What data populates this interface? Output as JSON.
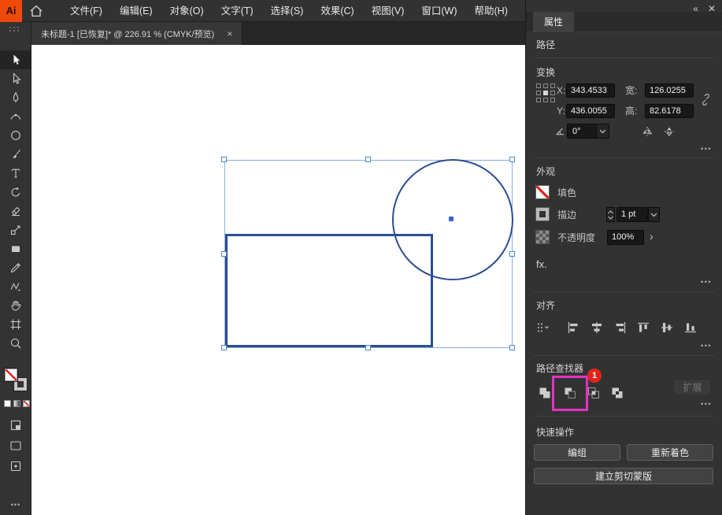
{
  "menubar": {
    "logo_text": "Ai",
    "items": [
      "文件(F)",
      "编辑(E)",
      "对象(O)",
      "文字(T)",
      "选择(S)",
      "效果(C)",
      "视图(V)",
      "窗口(W)",
      "帮助(H)"
    ]
  },
  "document_tab": {
    "title": "未标题-1 [已恢复]* @ 226.91 % (CMYK/预览)"
  },
  "icons": {
    "tab_close": "×",
    "collapse_panels": "«",
    "dock_close": "✕",
    "more_options": "•••",
    "opacity_expand": "›"
  },
  "toolbar_tools": [
    "selection",
    "direct-selection",
    "pen",
    "curvature",
    "ellipse",
    "paintbrush",
    "type",
    "rotate",
    "eraser",
    "scale",
    "rectangle",
    "pencil",
    "shaper",
    "hand",
    "artboard",
    "zoom"
  ],
  "panel": {
    "tab": "属性",
    "path": {
      "title": "路径"
    },
    "transform": {
      "title": "变换",
      "x_label": "X:",
      "x_value": "343.4533",
      "y_label": "Y:",
      "y_value": "436.0055",
      "w_label": "宽:",
      "w_value": "126.0255",
      "h_label": "高:",
      "h_value": "82.6178",
      "angle_value": "0°"
    },
    "appearance": {
      "title": "外观",
      "fill_label": "填色",
      "stroke_label": "描边",
      "stroke_value": "1 pt",
      "opacity_label": "不透明度",
      "opacity_value": "100%",
      "fx_label": "fx."
    },
    "align": {
      "title": "对齐"
    },
    "pathfinder": {
      "title": "路径查找器",
      "badge": "1",
      "expand": "扩展"
    },
    "quick": {
      "title": "快速操作",
      "group": "编组",
      "recolor": "重新着色",
      "clip_mask": "建立剪切蒙版"
    }
  },
  "colors": {
    "highlight_magenta": "#e332c4",
    "badge_red": "#e1251b",
    "selection_blue": "#84aede",
    "shape_stroke_blue": "#2d4d94",
    "logo_orange": "#f04a0a"
  }
}
